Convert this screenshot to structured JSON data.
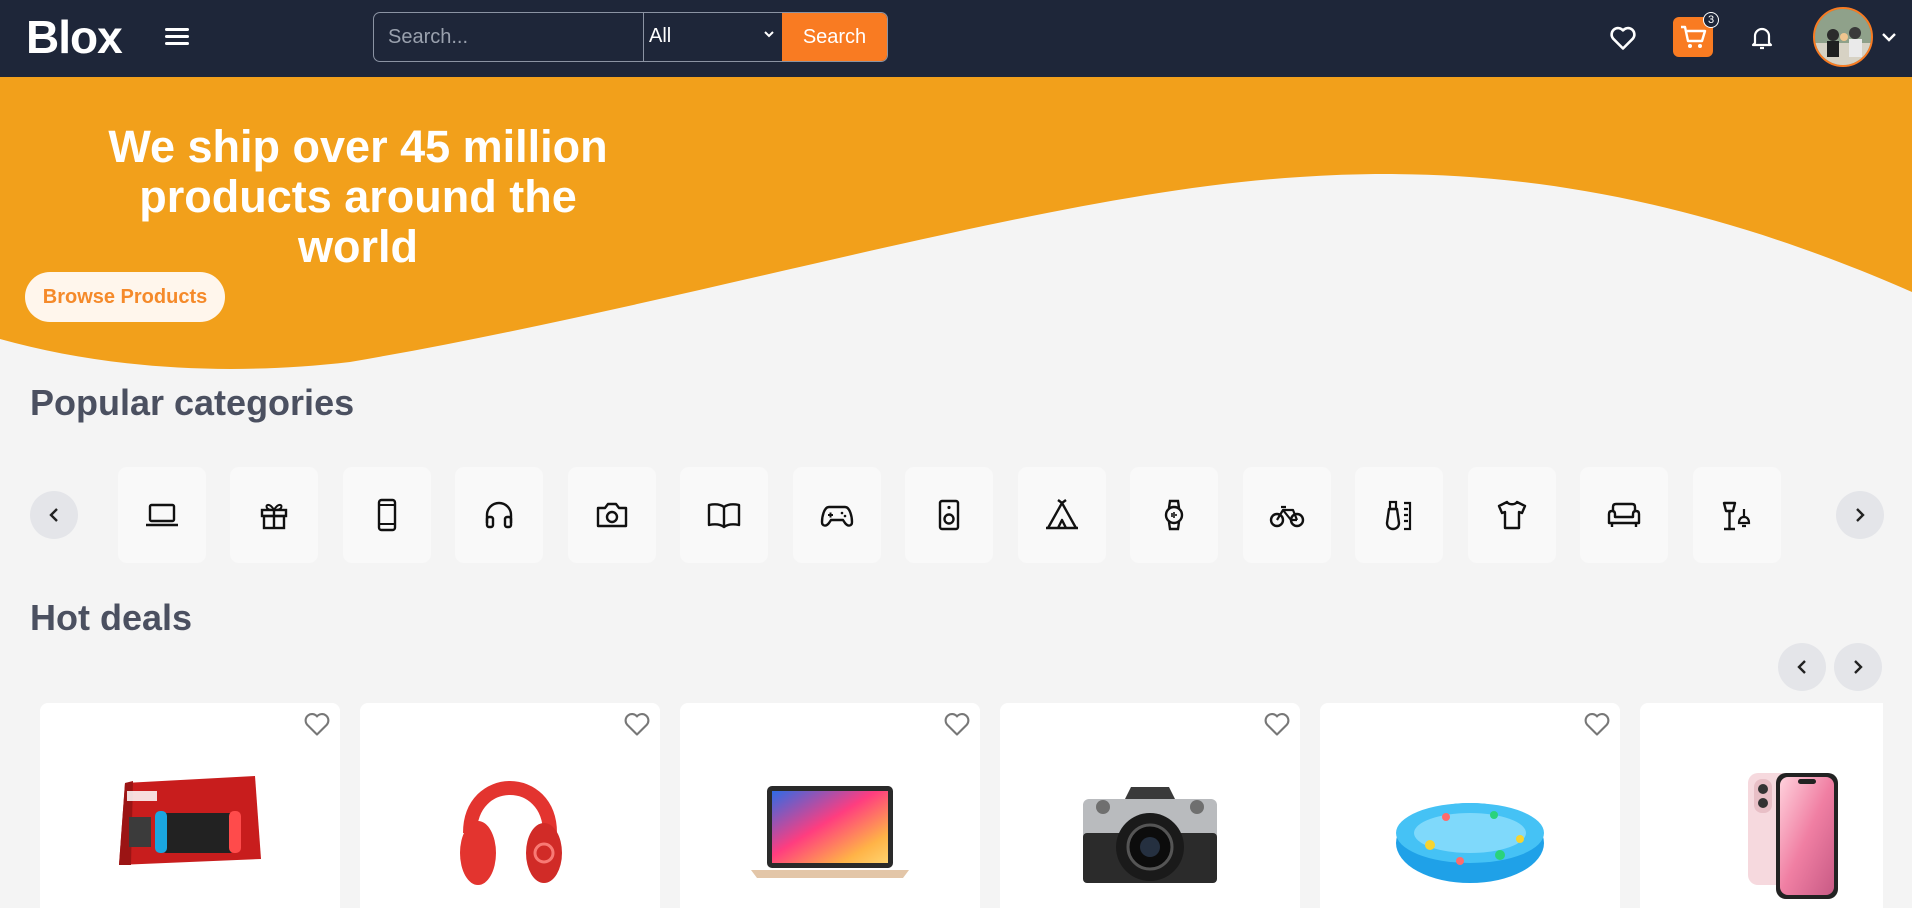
{
  "header": {
    "logo": "Blox",
    "search": {
      "placeholder": "Search...",
      "category_selected": "All",
      "button_label": "Search"
    },
    "cart_count": "3"
  },
  "hero": {
    "headline": "We ship over 45 million products around the world",
    "cta_label": "Browse Products",
    "colors": {
      "banner": "#f2a01b",
      "accent": "#f97b22",
      "header_bg": "#1e2639"
    }
  },
  "categories": {
    "title": "Popular categories",
    "icons": [
      "laptop-icon",
      "gift-icon",
      "smartphone-icon",
      "headphones-icon",
      "camera-icon",
      "book-icon",
      "gamepad-icon",
      "speaker-icon",
      "tent-icon",
      "smartwatch-icon",
      "bicycle-icon",
      "perfume-icon",
      "tshirt-icon",
      "sofa-icon",
      "lamp-icon"
    ]
  },
  "hot_deals": {
    "title": "Hot deals",
    "products": [
      {
        "image": "nintendo-switch-image"
      },
      {
        "image": "red-headphones-image"
      },
      {
        "image": "macbook-air-image"
      },
      {
        "image": "nikon-camera-image"
      },
      {
        "image": "inflatable-pool-image"
      },
      {
        "image": "pink-iphone-image"
      }
    ]
  }
}
